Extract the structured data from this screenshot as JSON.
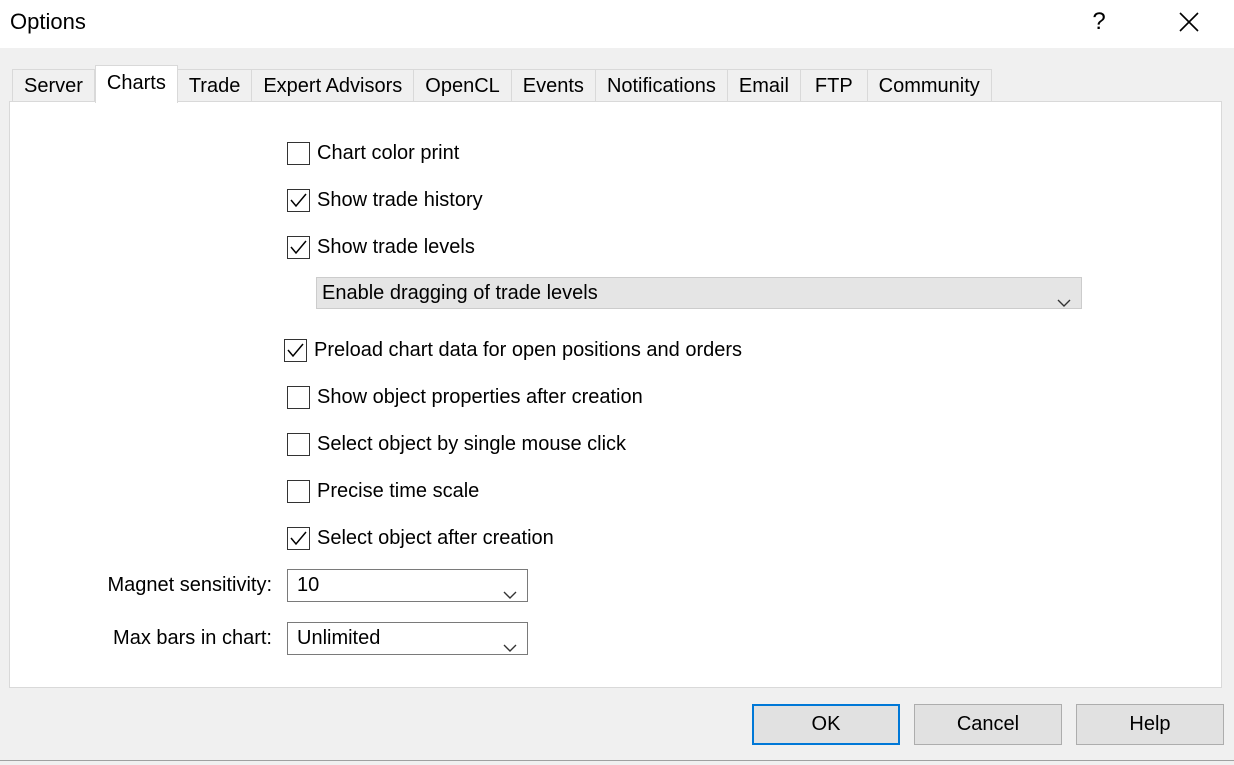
{
  "window": {
    "title": "Options",
    "help_label": "?",
    "close_icon": "close-icon"
  },
  "tabs": [
    {
      "label": "Server",
      "active": false
    },
    {
      "label": "Charts",
      "active": true
    },
    {
      "label": "Trade",
      "active": false
    },
    {
      "label": "Expert Advisors",
      "active": false
    },
    {
      "label": "OpenCL",
      "active": false
    },
    {
      "label": "Events",
      "active": false
    },
    {
      "label": "Notifications",
      "active": false
    },
    {
      "label": "Email",
      "active": false
    },
    {
      "label": "FTP",
      "active": false
    },
    {
      "label": "Community",
      "active": false
    }
  ],
  "options": {
    "chart_color_print": {
      "label": "Chart color print",
      "checked": false
    },
    "show_trade_history": {
      "label": "Show trade history",
      "checked": true
    },
    "show_trade_levels": {
      "label": "Show trade levels",
      "checked": true
    },
    "trade_levels_mode": {
      "value": "Enable dragging of trade levels"
    },
    "preload_chart_data": {
      "label": "Preload chart data for open positions and orders",
      "checked": true
    },
    "show_object_properties": {
      "label": "Show object properties after creation",
      "checked": false
    },
    "select_by_single_click": {
      "label": "Select object by single mouse click",
      "checked": false
    },
    "precise_time_scale": {
      "label": "Precise time scale",
      "checked": false
    },
    "select_after_creation": {
      "label": "Select object after creation",
      "checked": true
    }
  },
  "fields": {
    "magnet_sensitivity": {
      "label": "Magnet sensitivity:",
      "value": "10"
    },
    "max_bars": {
      "label": "Max bars in chart:",
      "value": "Unlimited"
    }
  },
  "buttons": {
    "ok": "OK",
    "cancel": "Cancel",
    "help": "Help"
  },
  "colors": {
    "accent": "#0078d7",
    "dialog_bg": "#f0f0f0",
    "panel_bg": "#ffffff"
  }
}
